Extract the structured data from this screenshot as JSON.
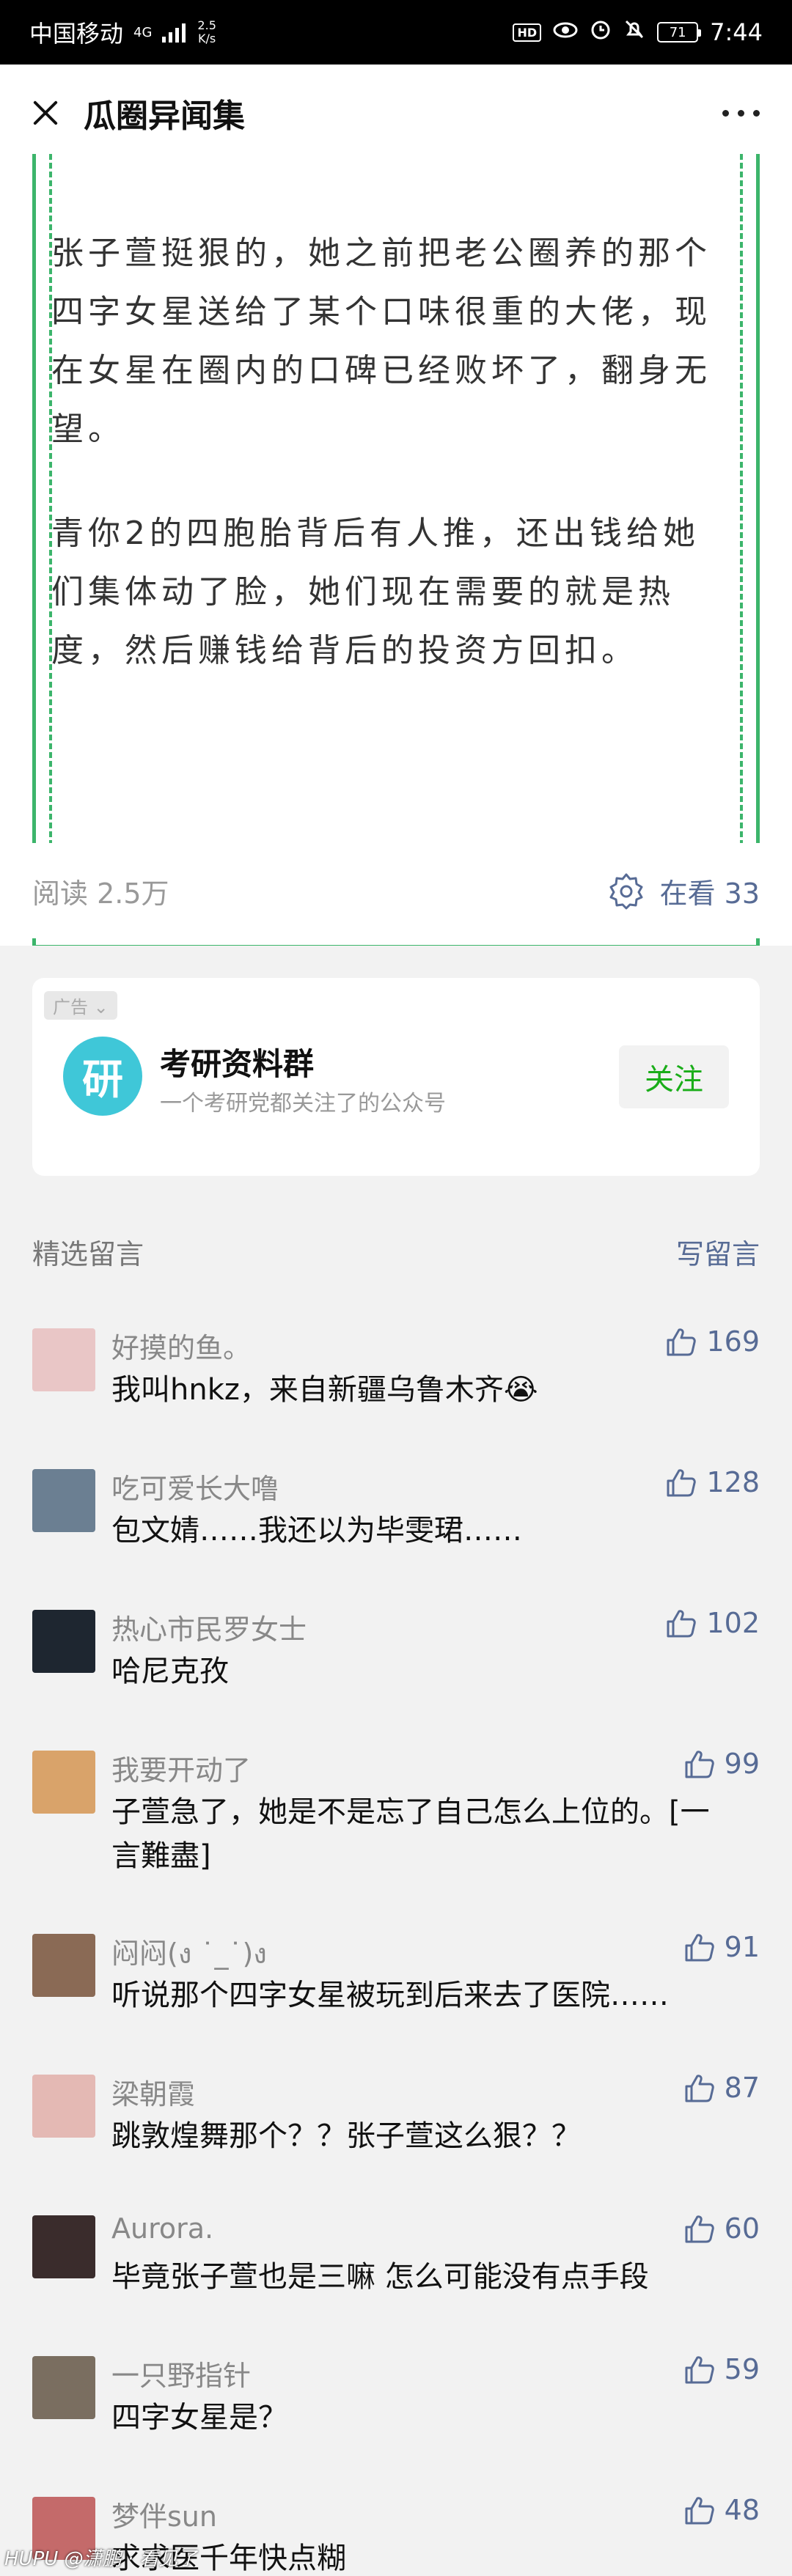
{
  "status_bar": {
    "carrier": "中国移动",
    "signal_label": "4G",
    "net_speed": "2.5",
    "net_unit": "K/s",
    "hd_badge": "HD",
    "battery": "71",
    "time": "7:44"
  },
  "nav": {
    "title": "瓜圈异闻集"
  },
  "article": {
    "paragraphs": [
      "张子萱挺狠的，她之前把老公圈养的那个四字女星送给了某个口味很重的大佬，现在女星在圈内的口碑已经败坏了，翻身无望。",
      "青你2的四胞胎背后有人推，还出钱给她们集体动了脸，她们现在需要的就是热度，然后赚钱给背后的投资方回扣。"
    ],
    "read_count": "阅读 2.5万",
    "watching": "在看 33",
    "border_color": "#3cb56b"
  },
  "ad": {
    "tag": "广告",
    "avatar_char": "研",
    "name": "考研资料群",
    "desc": "一个考研党都关注了的公众号",
    "follow": "关注"
  },
  "comments_section": {
    "title": "精选留言",
    "write": "写留言",
    "items": [
      {
        "name": "好摸的鱼。",
        "text": "我叫hnkz，来自新疆乌鲁木齐😭",
        "likes": "169",
        "avatar_color": "#e9c6c6"
      },
      {
        "name": "吃可爱长大噜",
        "text": "包文婧……我还以为毕雯珺……",
        "likes": "128",
        "avatar_color": "#6b7f92"
      },
      {
        "name": "热心市民罗女士",
        "text": "哈尼克孜",
        "likes": "102",
        "avatar_color": "#1e2630"
      },
      {
        "name": "我要开动了",
        "text": "子萱急了，她是不是忘了自己怎么上位的。[一言難盡]",
        "likes": "99",
        "avatar_color": "#d9a36a"
      },
      {
        "name": "闷闷(ง ˙_˙)ง",
        "text": "听说那个四字女星被玩到后来去了医院……",
        "likes": "91",
        "avatar_color": "#8a6a55"
      },
      {
        "name": "梁朝霞",
        "text": "跳敦煌舞那个？？张子萱这么狠？？",
        "likes": "87",
        "avatar_color": "#e4b9b4"
      },
      {
        "name": "Aurora.",
        "text": "毕竟张子萱也是三嘛 怎么可能没有点手段",
        "likes": "60",
        "avatar_color": "#3a2c2c"
      },
      {
        "name": "一只野指针",
        "text": "四字女星是？",
        "likes": "59",
        "avatar_color": "#7a6e60"
      },
      {
        "name": "梦伴sun",
        "text": "求求医千年快点糊",
        "likes": "48",
        "avatar_color": "#c46a6a"
      }
    ]
  },
  "watermark": "HUPU @潇鹏 · 看见了"
}
